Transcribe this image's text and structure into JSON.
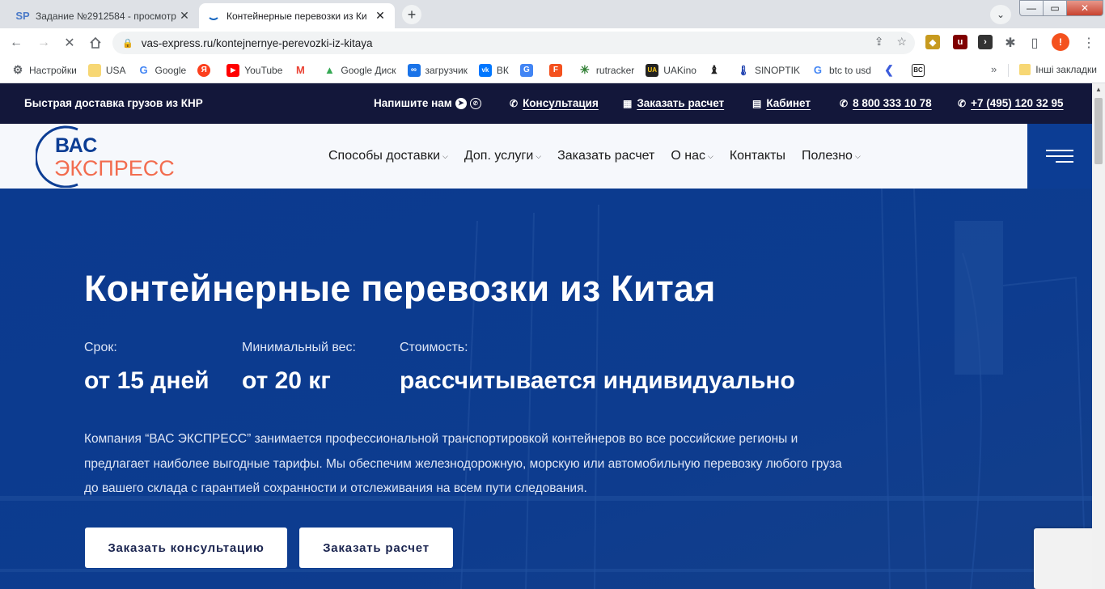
{
  "browser": {
    "tabs": [
      {
        "favicon": "SP",
        "title": "Задание №2912584 - просмотр",
        "active": false
      },
      {
        "favicon": "site-logo-icon",
        "title": "Контейнерные перевозки из Ки",
        "active": true
      }
    ],
    "new_tab": "+",
    "tab_search": "⌄",
    "window_controls": {
      "minimize": "—",
      "maximize": "▭",
      "close": "✕"
    },
    "url": "vas-express.ru/kontejnernye-perevozki-iz-kitaya",
    "profile_initial": "!",
    "bookmarks": [
      {
        "label": "Настройки",
        "icon": "gear-icon"
      },
      {
        "label": "USA",
        "icon": "folder-icon"
      },
      {
        "label": "Google",
        "icon": "google-icon"
      },
      {
        "label": "",
        "icon": "yandex-icon"
      },
      {
        "label": "YouTube",
        "icon": "youtube-icon"
      },
      {
        "label": "",
        "icon": "gmail-icon"
      },
      {
        "label": "Google Диск",
        "icon": "google-drive-icon"
      },
      {
        "label": "загрузчик",
        "icon": "loader-icon"
      },
      {
        "label": "ВК",
        "icon": "vk-icon"
      },
      {
        "label": "",
        "icon": "google-translate-icon"
      },
      {
        "label": "",
        "icon": "f-icon"
      },
      {
        "label": "rutracker",
        "icon": "rutracker-icon"
      },
      {
        "label": "UAKino",
        "icon": "uakino-icon"
      },
      {
        "label": "",
        "icon": "chess-icon"
      },
      {
        "label": "SINOPTIK",
        "icon": "thermometer-icon"
      },
      {
        "label": "btc to usd",
        "icon": "google-icon"
      },
      {
        "label": "",
        "icon": "arrow-icon"
      },
      {
        "label": "",
        "icon": "bc-icon"
      }
    ],
    "bookmarks_more": "»",
    "other_bookmarks": "Інші закладки"
  },
  "site": {
    "topbar": {
      "slogan": "Быстрая доставка грузов из КНР",
      "write_us": "Напишите нам",
      "consultation": "Консультация",
      "order_calc": "Заказать расчет",
      "cabinet": "Кабинет",
      "phone1": "8 800 333 10 78",
      "phone2": "+7 (495) 120 32 95"
    },
    "logo": {
      "line1": "ВАС",
      "line2": "ЭКСПРЕСС"
    },
    "nav": [
      {
        "label": "Способы доставки",
        "dropdown": true
      },
      {
        "label": "Доп. услуги",
        "dropdown": true
      },
      {
        "label": "Заказать расчет",
        "dropdown": false
      },
      {
        "label": "О нас",
        "dropdown": true
      },
      {
        "label": "Контакты",
        "dropdown": false
      },
      {
        "label": "Полезно",
        "dropdown": true
      }
    ],
    "hero": {
      "title": "Контейнерные перевозки из Китая",
      "params": [
        {
          "label": "Срок:",
          "value": "от 15 дней"
        },
        {
          "label": "Минимальный вес:",
          "value": "от 20 кг"
        },
        {
          "label": "Стоимость:",
          "value": "рассчитывается индивидуально"
        }
      ],
      "description": "Компания “ВАС ЭКСПРЕСС” занимается профессиональной транспортировкой контейнеров во все российские регионы и предлагает наиболее выгодные тарифы. Мы обеспечим железнодорожную, морскую или автомобильную перевозку любого груза до вашего склада с гарантией сохранности и отслеживания на всем пути следования.",
      "btn_consult": "Заказать консультацию",
      "btn_calc": "Заказать расчет"
    }
  },
  "colors": {
    "topbar_bg": "#13173a",
    "hero_bg": "#0c3a8d",
    "brand_blue": "#0c3d94",
    "brand_orange": "#f26c4f"
  }
}
